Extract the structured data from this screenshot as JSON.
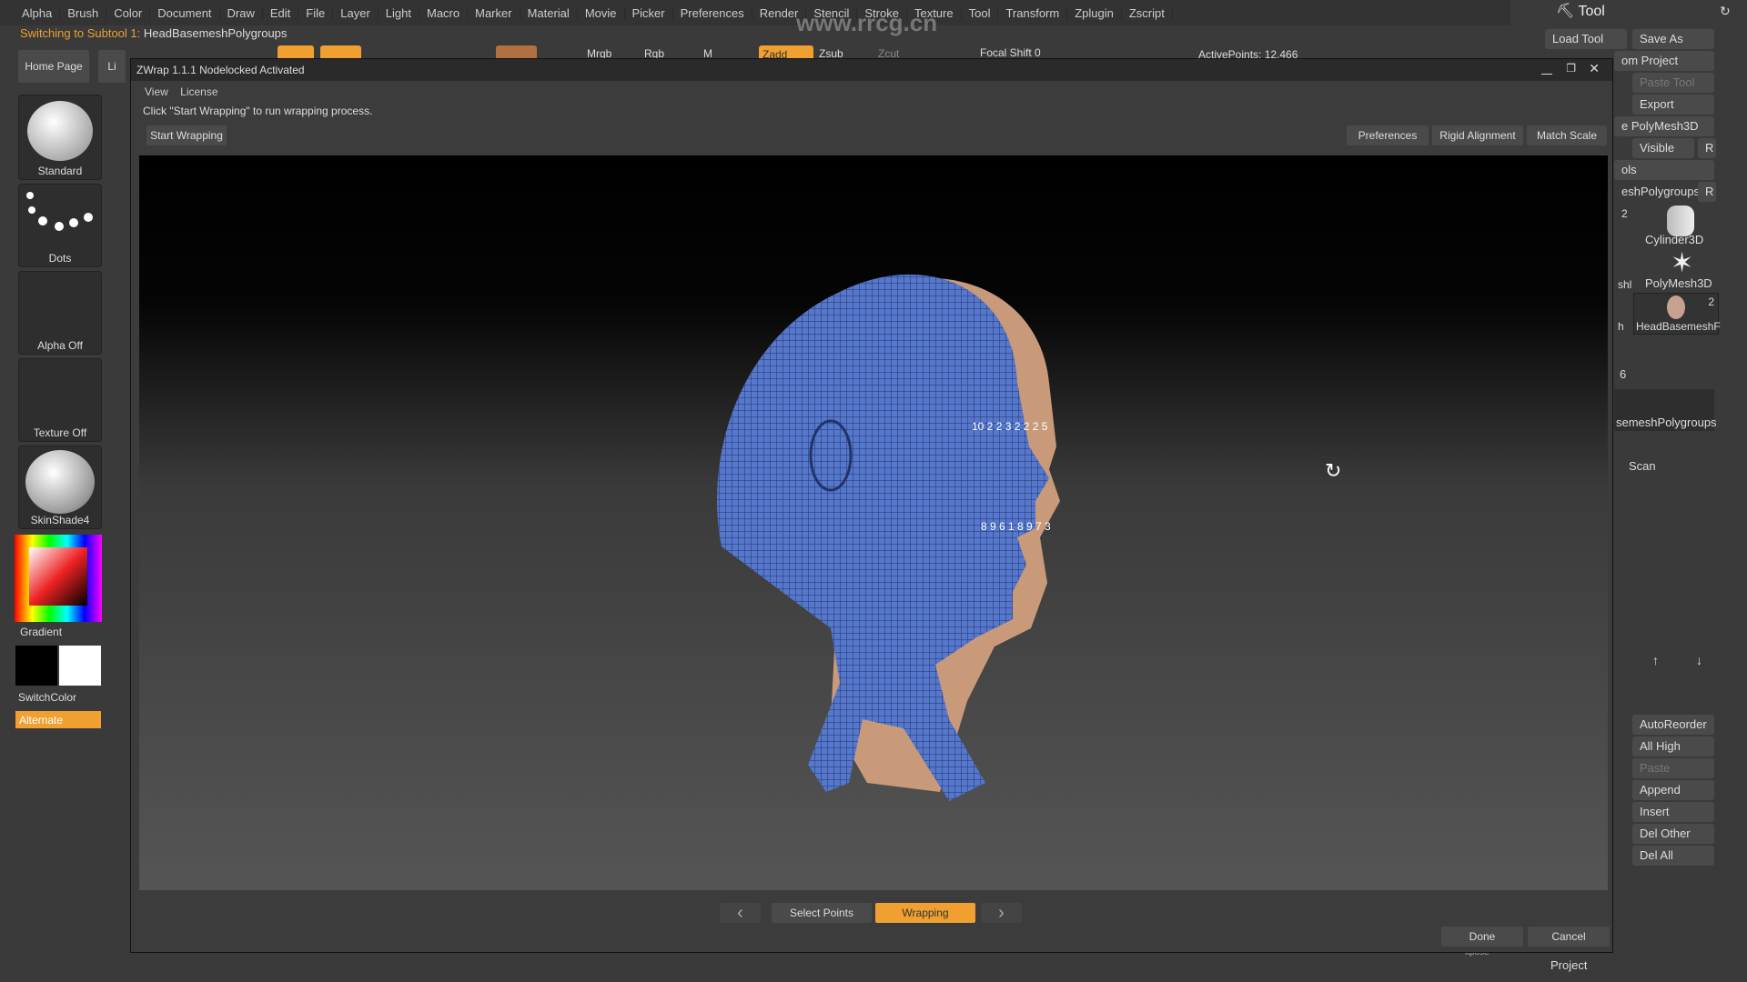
{
  "menu": [
    "Alpha",
    "Brush",
    "Color",
    "Document",
    "Draw",
    "Edit",
    "File",
    "Layer",
    "Light",
    "Macro",
    "Marker",
    "Material",
    "Movie",
    "Picker",
    "Preferences",
    "Render",
    "Stencil",
    "Stroke",
    "Texture",
    "Tool",
    "Transform",
    "Zplugin",
    "Zscript"
  ],
  "status": {
    "prefix": "Switching to Subtool 1:",
    "name": "HeadBasemeshPolygroups"
  },
  "watermark": "www.rrcg.cn",
  "toolbar": {
    "mrgb": "Mrgb",
    "rgb": "Rgb",
    "m": "M",
    "zadd": "Zadd",
    "zsub": "Zsub",
    "zcut": "Zcut",
    "focal": "Focal Shift 0",
    "active": "ActivePoints: 12,466"
  },
  "left": {
    "home": "Home Page",
    "lightbox": "Li",
    "brush": "Standard",
    "stroke": "Dots",
    "alpha": "Alpha Off",
    "texture": "Texture Off",
    "material": "SkinShade4",
    "gradient": "Gradient",
    "switch": "SwitchColor",
    "alternate": "Alternate"
  },
  "zwrap": {
    "title": "ZWrap 1.1.1  Nodelocked Activated",
    "menu": [
      "View",
      "License"
    ],
    "instruction": "Click \"Start Wrapping\" to run wrapping process.",
    "start": "Start Wrapping",
    "preferences": "Preferences",
    "rigid": "Rigid Alignment",
    "match": "Match Scale",
    "select_points": "Select Points",
    "wrapping": "Wrapping",
    "done": "Done",
    "cancel": "Cancel",
    "markers_eye": "10 2 2 3 2 2 2 5",
    "markers_mouth": "8 9 6 1 8 9 7 3"
  },
  "tool": {
    "title": "Tool",
    "load": "Load Tool",
    "save": "Save As",
    "from_project": "om Project",
    "paste": "Paste Tool",
    "export": "Export",
    "polymesh": "e PolyMesh3D",
    "visible": "Visible",
    "r": "R",
    "tools": "ols",
    "current": "eshPolygroups.",
    "count": "2",
    "cyl": "Cylinder3D",
    "poly": "PolyMesh3D",
    "head": "HeadBasemeshF",
    "head_count": "2",
    "sh": "shl",
    "h": "h",
    "subtool_count": "6",
    "subtool_name": "semeshPolygroups",
    "scan": "Scan",
    "autoreorder": "AutoReorder",
    "allhigh": "All High",
    "paste2": "Paste",
    "append": "Append",
    "insert": "Insert",
    "delother": "Del Other",
    "delall": "Del All",
    "project": "Project",
    "xpose": "xpose"
  },
  "colors": {
    "accent": "#f0a030",
    "mesh": "#5577cc",
    "skin": "#c89a7a"
  }
}
